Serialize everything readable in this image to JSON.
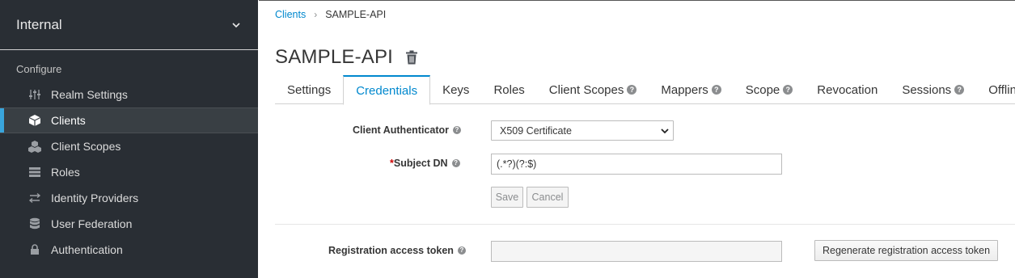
{
  "sidebar": {
    "realm": "Internal",
    "section": "Configure",
    "items": [
      {
        "label": "Realm Settings",
        "icon": "sliders-icon"
      },
      {
        "label": "Clients",
        "icon": "cube-icon"
      },
      {
        "label": "Client Scopes",
        "icon": "cubes-icon"
      },
      {
        "label": "Roles",
        "icon": "list-icon"
      },
      {
        "label": "Identity Providers",
        "icon": "exchange-icon"
      },
      {
        "label": "User Federation",
        "icon": "database-icon"
      },
      {
        "label": "Authentication",
        "icon": "lock-icon"
      }
    ],
    "active_item": "Clients",
    "accent_color": "#39a5dc"
  },
  "breadcrumb": {
    "link": "Clients",
    "separator": "›",
    "current": "SAMPLE-API"
  },
  "page": {
    "title": "SAMPLE-API"
  },
  "tabs": [
    {
      "label": "Settings"
    },
    {
      "label": "Credentials"
    },
    {
      "label": "Keys"
    },
    {
      "label": "Roles"
    },
    {
      "label": "Client Scopes"
    },
    {
      "label": "Mappers"
    },
    {
      "label": "Scope"
    },
    {
      "label": "Revocation"
    },
    {
      "label": "Sessions"
    },
    {
      "label": "Offline A"
    }
  ],
  "active_tab": "Credentials",
  "form": {
    "client_authenticator_label": "Client Authenticator",
    "client_authenticator_value": "X509 Certificate",
    "subject_dn_required": "*",
    "subject_dn_label": "Subject DN",
    "subject_dn_value": "(.*?)(?:$)",
    "save_label": "Save",
    "cancel_label": "Cancel",
    "registration_token_label": "Registration access token",
    "registration_token_value": "",
    "regenerate_label": "Regenerate registration access token"
  },
  "help_glyph": "?"
}
